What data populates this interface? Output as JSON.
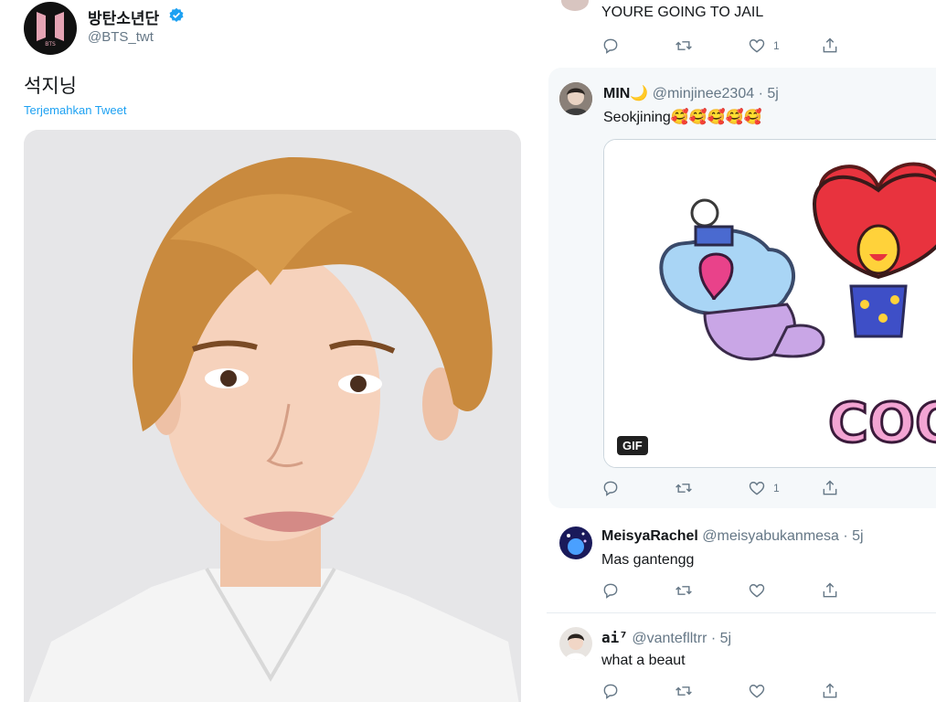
{
  "main_tweet": {
    "author_name": "방탄소년단",
    "author_handle": "@BTS_twt",
    "text": "석지닝",
    "translate_label": "Terjemahkan Tweet"
  },
  "replies": [
    {
      "text": "YOURE GOING TO JAIL",
      "likes": "1"
    },
    {
      "name": "MIN🌙",
      "handle_time": "@minjinee2304 · 5j",
      "text": "Seokjining🥰🥰🥰🥰🥰",
      "gif_label": "GIF",
      "gif_text": "COO",
      "likes": "1"
    },
    {
      "name": "MeisyaRachel",
      "handle_time": "@meisyabukanmesa · 5j",
      "text": "Mas gantengg"
    },
    {
      "name": "ai⁷",
      "handle_time": "@vanteflltrr · 5j",
      "text": "what a beaut"
    }
  ],
  "icons": [
    "reply-icon",
    "retweet-icon",
    "like-icon",
    "share-icon",
    "verified-icon"
  ],
  "colors": {
    "link": "#1da1f2",
    "secondary_text": "#657786",
    "highlight_bg": "#f5f8fa"
  }
}
